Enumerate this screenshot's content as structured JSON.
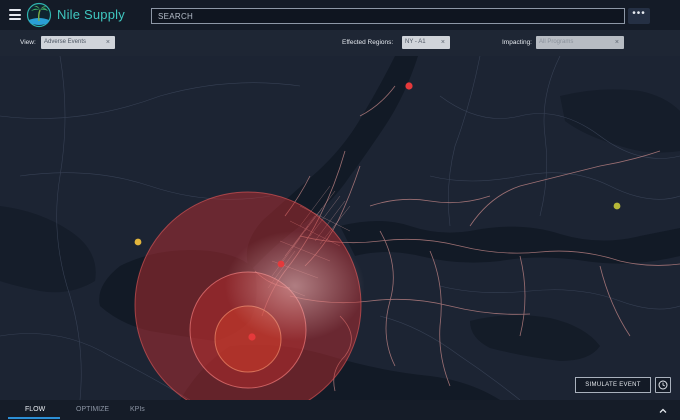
{
  "header": {
    "brand": "Nile Supply",
    "search_placeholder": "SEARCH",
    "more_label": "•••"
  },
  "filters": {
    "view_label": "View:",
    "view_value": "Adverse Events",
    "regions_label": "Effected Regions:",
    "regions_value": "NY - A1",
    "impacting_label": "Impacting:",
    "impacting_value": "All Programs",
    "remove_glyph": "×"
  },
  "map": {
    "event_markers": [
      {
        "name": "north-event",
        "color": "#e5393b"
      },
      {
        "name": "west-event",
        "color": "#e2b53c"
      },
      {
        "name": "east-event",
        "color": "#b6b838"
      },
      {
        "name": "manhattan-event",
        "color": "#e5393b"
      },
      {
        "name": "epicenter-event",
        "color": "#e5393b"
      }
    ],
    "impact_zone_color": "#d6302f"
  },
  "actions": {
    "simulate_label": "SIMULATE EVENT"
  },
  "tabs": [
    {
      "label": "FLOW",
      "active": true
    },
    {
      "label": "OPTIMIZE",
      "active": false
    },
    {
      "label": "KPIs",
      "active": false
    }
  ],
  "colors": {
    "brand": "#3fc7c0",
    "tab_accent": "#2c8fd6",
    "roads": "#c98a8a"
  }
}
